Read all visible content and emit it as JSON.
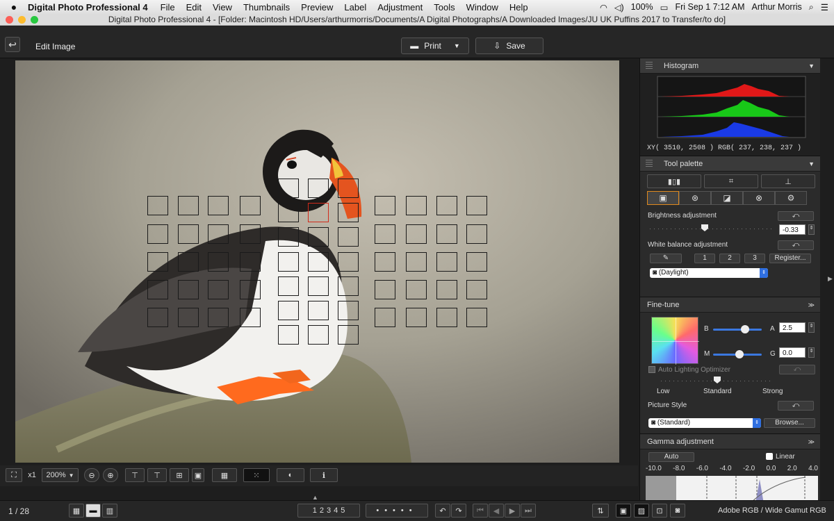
{
  "menubar": {
    "app_name": "Digital Photo Professional 4",
    "items": [
      "File",
      "Edit",
      "View",
      "Thumbnails",
      "Preview",
      "Label",
      "Adjustment",
      "Tools",
      "Window",
      "Help"
    ],
    "battery": "100%",
    "clock": "Fri Sep 1  7:12 AM",
    "user": "Arthur Morris"
  },
  "titlebar": {
    "title": "Digital Photo Professional 4 - [Folder: Macintosh HD/Users/arthurmorris/Documents/A Digital Photographs/A Downloaded Images/JU UK Puffins 2017 to Transfer/to do]"
  },
  "toolbar": {
    "edit_label": "Edit Image",
    "print_label": "Print",
    "save_label": "Save"
  },
  "histogram": {
    "title": "Histogram",
    "readout": "XY(  3510,   2508 ) RGB( 237,  238,  237 )"
  },
  "tool_palette": {
    "title": "Tool palette",
    "brightness_label": "Brightness adjustment",
    "brightness_value": "-0.33",
    "wb_label": "White balance adjustment",
    "wb_buttons": [
      "1",
      "2",
      "3"
    ],
    "register_label": "Register...",
    "wb_preset": "(Daylight)",
    "finetune_title": "Fine-tune",
    "b_label": "B",
    "a_label": "A",
    "a_value": "2.5",
    "m_label": "M",
    "g_label": "G",
    "g_value": "0.0",
    "alo_label": "Auto Lighting Optimizer",
    "alo_levels": [
      "Low",
      "Standard",
      "Strong"
    ],
    "picture_style_label": "Picture Style",
    "picture_style_value": "(Standard)",
    "browse_label": "Browse...",
    "gamma_title": "Gamma adjustment",
    "auto_label": "Auto",
    "linear_label": "Linear",
    "gamma_scale": [
      "-10.0",
      "-8.0",
      "-6.0",
      "-4.0",
      "-2.0",
      "0.0",
      "2.0",
      "4.0"
    ]
  },
  "viewer_controls": {
    "fit_label": "x1",
    "zoom_value": "200%"
  },
  "status": {
    "page": "1 / 28",
    "stars": [
      "1",
      "2",
      "3",
      "4",
      "5"
    ],
    "color_space": "Adobe RGB / Wide Gamut RGB"
  }
}
